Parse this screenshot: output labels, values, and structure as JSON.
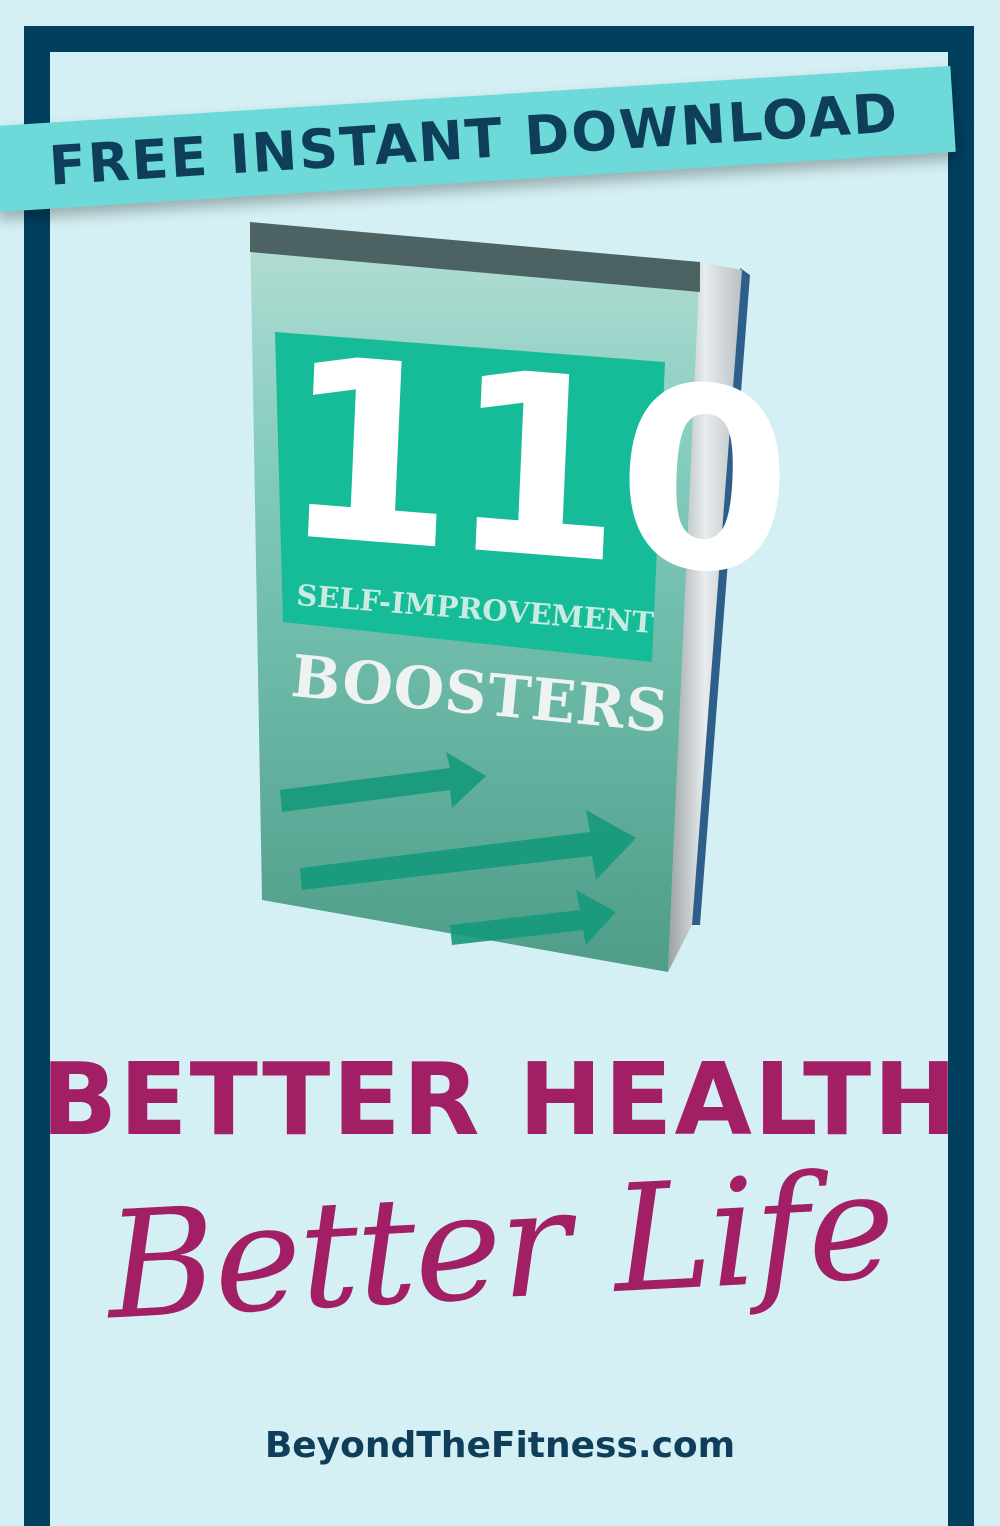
{
  "banner": {
    "text": "FREE INSTANT DOWNLOAD"
  },
  "book": {
    "number": "110",
    "subtitle": "SELF-IMPROVEMENT",
    "title": "BOOSTERS"
  },
  "headline": "BETTER HEALTH",
  "tagline": "Better Life",
  "website": "BeyondTheFitness.com",
  "colors": {
    "background": "#d4f0f4",
    "frame": "#003f5e",
    "banner": "#6dd9d8",
    "accent": "#a21f66",
    "book_cover": "#5fbfae",
    "number_box": "#16bc98"
  }
}
